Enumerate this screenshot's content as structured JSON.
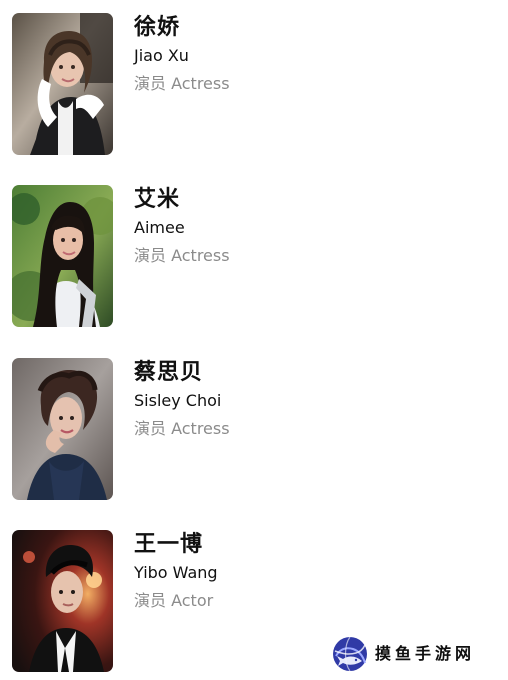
{
  "cast": [
    {
      "name_cn": "徐娇",
      "name_en": "Jiao Xu",
      "role": "演员 Actress"
    },
    {
      "name_cn": "艾米",
      "name_en": "Aimee",
      "role": "演员 Actress"
    },
    {
      "name_cn": "蔡思贝",
      "name_en": "Sisley Choi",
      "role": "演员 Actress"
    },
    {
      "name_cn": "王一博",
      "name_en": "Yibo Wang",
      "role": "演员 Actor"
    }
  ],
  "watermark": {
    "text": "摸鱼手游网"
  }
}
